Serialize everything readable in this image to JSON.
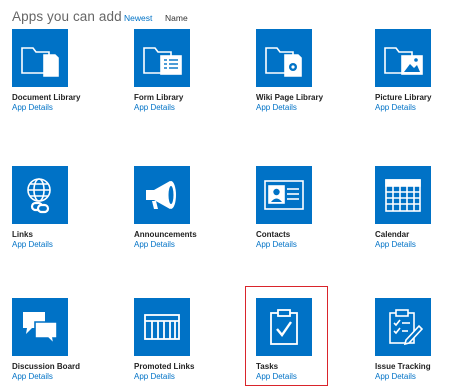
{
  "header": {
    "title": "Apps you can add",
    "sort_options": [
      "Newest",
      "Name"
    ]
  },
  "accent_color": "#0072c6",
  "highlight_color": "#d9242b",
  "apps": [
    {
      "name": "Document Library",
      "details": "App Details",
      "icon": "document-library-icon"
    },
    {
      "name": "Form Library",
      "details": "App Details",
      "icon": "form-library-icon"
    },
    {
      "name": "Wiki Page Library",
      "details": "App Details",
      "icon": "wiki-page-library-icon"
    },
    {
      "name": "Picture Library",
      "details": "App Details",
      "icon": "picture-library-icon"
    },
    {
      "name": "Links",
      "details": "App Details",
      "icon": "links-globe-icon"
    },
    {
      "name": "Announcements",
      "details": "App Details",
      "icon": "megaphone-icon"
    },
    {
      "name": "Contacts",
      "details": "App Details",
      "icon": "contact-card-icon"
    },
    {
      "name": "Calendar",
      "details": "App Details",
      "icon": "calendar-icon"
    },
    {
      "name": "Discussion Board",
      "details": "App Details",
      "icon": "discussion-bubbles-icon"
    },
    {
      "name": "Promoted Links",
      "details": "App Details",
      "icon": "promoted-links-icon"
    },
    {
      "name": "Tasks",
      "details": "App Details",
      "icon": "tasks-clipboard-icon",
      "selected": true
    },
    {
      "name": "Issue Tracking",
      "details": "App Details",
      "icon": "issue-tracking-icon"
    }
  ]
}
